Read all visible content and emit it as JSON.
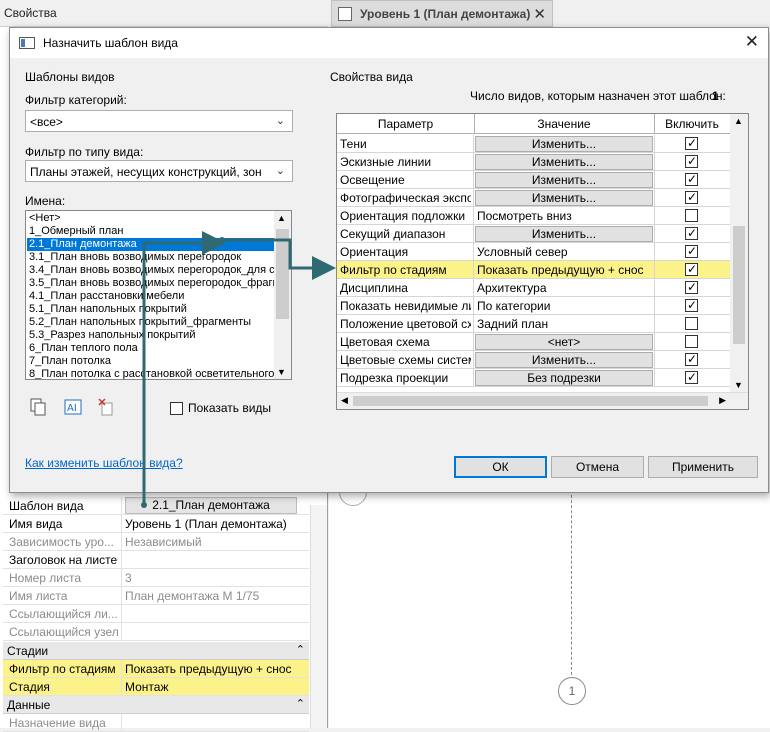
{
  "background": {
    "props_title": "Свойства",
    "view_tab": {
      "label": "Уровень 1 (План демонтажа)",
      "close": "✕"
    },
    "grid_bubble": "1",
    "properties": [
      {
        "key": "Шаблон вида",
        "value": "2.1_План демонтажа",
        "style": "button"
      },
      {
        "key": "Имя вида",
        "value": "Уровень 1 (План демонтажа)",
        "style": "normal"
      },
      {
        "key": "Зависимость уро...",
        "value": "Независимый",
        "style": "gray"
      },
      {
        "key": "Заголовок на листе",
        "value": "",
        "style": "normal"
      },
      {
        "key": "Номер листа",
        "value": "3",
        "style": "gray"
      },
      {
        "key": "Имя листа",
        "value": "План демонтажа М 1/75",
        "style": "gray"
      },
      {
        "key": "Ссылающийся ли...",
        "value": "",
        "style": "gray"
      },
      {
        "key": "Ссылающийся узел",
        "value": "",
        "style": "gray"
      }
    ],
    "section_stages": "Стадии",
    "stage_rows": [
      {
        "key": "Фильтр по стадиям",
        "value": "Показать предыдущую + снос"
      },
      {
        "key": "Стадия",
        "value": "Монтаж"
      }
    ],
    "section_data": "Данные",
    "data_rows": [
      {
        "key": "Назначение вида",
        "value": ""
      }
    ]
  },
  "dialog": {
    "title": "Назначить шаблон вида",
    "close": "✕",
    "templates_group": "Шаблоны видов",
    "category_filter_label": "Фильтр категорий:",
    "category_filter_value": "<все>",
    "view_type_filter_label": "Фильтр по типу вида:",
    "view_type_filter_value": "Планы этажей, несущих конструкций, зон",
    "names_label": "Имена:",
    "names": [
      "<Нет>",
      "1_Обмерный план",
      "2.1_План демонтажа",
      "3.1_План вновь возводимых перегородок",
      "3.4_План вновь возводимых перегородок_для с",
      "3.5_План вновь возводимых перегородок_фрагм",
      "4.1_План расстановки мебели",
      "5.1_План напольных покрытий",
      "5.2_План напольных покрытий_фрагменты",
      "5.3_Разрез напольных покрытий",
      "6_План теплого пола",
      "7_План потолка",
      "8_План потолка с расстановкой осветительного"
    ],
    "selected_name_index": 2,
    "show_views_label": "Показать виды",
    "help_link": "Как изменить шаблон вида?",
    "props_group": "Свойства вида",
    "assigned_count_label": "Число видов, которым назначен этот шаблон:",
    "assigned_count_value": "1",
    "columns": {
      "param": "Параметр",
      "value": "Значение",
      "include": "Включить"
    },
    "rows": [
      {
        "param": "Тени",
        "value": "Изменить...",
        "button": true,
        "include": true,
        "highlight": false
      },
      {
        "param": "Эскизные линии",
        "value": "Изменить...",
        "button": true,
        "include": true,
        "highlight": false
      },
      {
        "param": "Освещение",
        "value": "Изменить...",
        "button": true,
        "include": true,
        "highlight": false
      },
      {
        "param": "Фотографическая экспо",
        "value": "Изменить...",
        "button": true,
        "include": true,
        "highlight": false
      },
      {
        "param": "Ориентация подложки",
        "value": "Посмотреть вниз",
        "button": false,
        "include": false,
        "highlight": false
      },
      {
        "param": "Секущий диапазон",
        "value": "Изменить...",
        "button": true,
        "include": true,
        "highlight": false
      },
      {
        "param": "Ориентация",
        "value": "Условный север",
        "button": false,
        "include": true,
        "highlight": false
      },
      {
        "param": "Фильтр по стадиям",
        "value": "Показать предыдущую + снос",
        "button": false,
        "include": true,
        "highlight": true
      },
      {
        "param": "Дисциплина",
        "value": "Архитектура",
        "button": false,
        "include": true,
        "highlight": false
      },
      {
        "param": "Показать невидимые ли",
        "value": "По категории",
        "button": false,
        "include": true,
        "highlight": false
      },
      {
        "param": "Положение цветовой сх",
        "value": "Задний план",
        "button": false,
        "include": false,
        "highlight": false
      },
      {
        "param": "Цветовая схема",
        "value": "<нет>",
        "button": true,
        "include": false,
        "highlight": false
      },
      {
        "param": "Цветовые схемы систем",
        "value": "Изменить...",
        "button": true,
        "include": true,
        "highlight": false
      },
      {
        "param": "Подрезка проекции",
        "value": "Без подрезки",
        "button": true,
        "include": true,
        "highlight": false
      }
    ],
    "buttons": {
      "ok": "ОК",
      "cancel": "Отмена",
      "apply": "Применить"
    }
  },
  "colors": {
    "highlight": "#fbf28a",
    "selection": "#0078d7",
    "annotation": "#2f6a73"
  }
}
